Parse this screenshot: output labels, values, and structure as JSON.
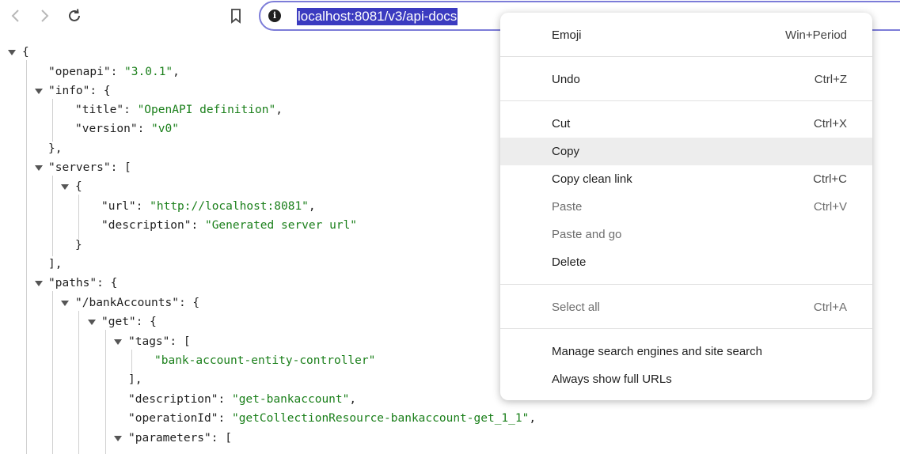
{
  "browser": {
    "url": "localhost:8081/v3/api-docs"
  },
  "json_lines": [
    {
      "text": "{"
    },
    {
      "key": "\"openapi\"",
      "sep": ": ",
      "str": "\"3.0.1\"",
      "tail": ","
    },
    {
      "key": "\"info\"",
      "sep": ": {"
    },
    {
      "key": "\"title\"",
      "sep": ": ",
      "str": "\"OpenAPI definition\"",
      "tail": ","
    },
    {
      "key": "\"version\"",
      "sep": ": ",
      "str": "\"v0\""
    },
    {
      "text": "},"
    },
    {
      "key": "\"servers\"",
      "sep": ": ["
    },
    {
      "text": "{"
    },
    {
      "key": "\"url\"",
      "sep": ": ",
      "str": "\"http://localhost:8081\"",
      "tail": ","
    },
    {
      "key": "\"description\"",
      "sep": ": ",
      "str": "\"Generated server url\""
    },
    {
      "text": "}"
    },
    {
      "text": "],"
    },
    {
      "key": "\"paths\"",
      "sep": ": {"
    },
    {
      "key": "\"/bankAccounts\"",
      "sep": ": {"
    },
    {
      "key": "\"get\"",
      "sep": ": {"
    },
    {
      "key": "\"tags\"",
      "sep": ": ["
    },
    {
      "str": "\"bank-account-entity-controller\""
    },
    {
      "text": "],"
    },
    {
      "key": "\"description\"",
      "sep": ": ",
      "str": "\"get-bankaccount\"",
      "tail": ","
    },
    {
      "key": "\"operationId\"",
      "sep": ": ",
      "str": "\"getCollectionResource-bankaccount-get_1_1\"",
      "tail": ","
    },
    {
      "key": "\"parameters\"",
      "sep": ": ["
    }
  ],
  "context_menu": {
    "items": [
      {
        "label": "Emoji",
        "shortcut": "Win+Period"
      },
      {
        "label": "Undo",
        "shortcut": "Ctrl+Z"
      },
      {
        "label": "Cut",
        "shortcut": "Ctrl+X"
      },
      {
        "label": "Copy",
        "shortcut": ""
      },
      {
        "label": "Copy clean link",
        "shortcut": "Ctrl+C"
      },
      {
        "label": "Paste",
        "shortcut": "Ctrl+V"
      },
      {
        "label": "Paste and go",
        "shortcut": ""
      },
      {
        "label": "Delete",
        "shortcut": ""
      },
      {
        "label": "Select all",
        "shortcut": "Ctrl+A"
      },
      {
        "label": "Manage search engines and site search",
        "shortcut": ""
      },
      {
        "label": "Always show full URLs",
        "shortcut": ""
      }
    ]
  }
}
